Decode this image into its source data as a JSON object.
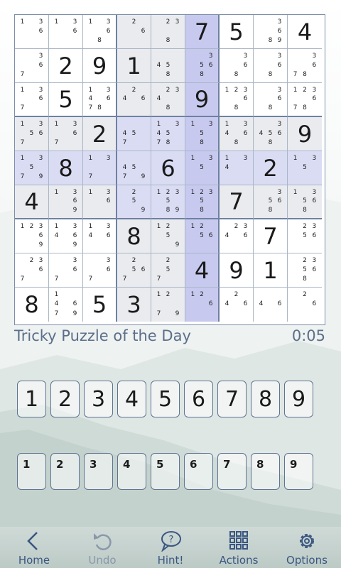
{
  "theme": {
    "accent": "#3a5780",
    "highlight": "#dadcf4",
    "selected": "#b7b9ea",
    "grid_line": "#6e81a1",
    "box_shade": "#e9ebee"
  },
  "board": {
    "selected_cell": [
      4,
      5
    ],
    "cells": [
      [
        {
          "n": [
            1,
            3,
            6
          ]
        },
        {
          "n": [
            1,
            3,
            6
          ]
        },
        {
          "n": [
            1,
            3,
            6,
            8
          ]
        },
        {
          "n": [
            2,
            6
          ]
        },
        {
          "n": [
            2,
            3,
            8
          ]
        },
        {
          "v": 7
        },
        {
          "v": 5
        },
        {
          "n": [
            3,
            6,
            8,
            9
          ]
        },
        {
          "v": 4
        }
      ],
      [
        {
          "n": [
            3,
            6,
            7
          ]
        },
        {
          "v": 2
        },
        {
          "v": 9
        },
        {
          "v": 1
        },
        {
          "n": [
            4,
            5,
            8
          ]
        },
        {
          "n": [
            3,
            5,
            6,
            8
          ]
        },
        {
          "n": [
            3,
            6,
            8
          ]
        },
        {
          "n": [
            3,
            6,
            8
          ]
        },
        {
          "n": [
            3,
            6,
            7,
            8
          ]
        }
      ],
      [
        {
          "n": [
            1,
            3,
            6,
            7
          ]
        },
        {
          "v": 5
        },
        {
          "n": [
            1,
            3,
            4,
            6,
            7,
            8
          ]
        },
        {
          "n": [
            2,
            4,
            6
          ]
        },
        {
          "n": [
            2,
            3,
            4,
            8
          ]
        },
        {
          "v": 9
        },
        {
          "n": [
            1,
            2,
            3,
            6,
            8
          ]
        },
        {
          "n": [
            3,
            6,
            8
          ]
        },
        {
          "n": [
            1,
            2,
            3,
            6,
            7,
            8
          ]
        }
      ],
      [
        {
          "n": [
            1,
            3,
            5,
            6,
            7
          ]
        },
        {
          "n": [
            1,
            3,
            6,
            7
          ]
        },
        {
          "v": 2
        },
        {
          "n": [
            4,
            5,
            7
          ]
        },
        {
          "n": [
            1,
            3,
            4,
            5,
            7,
            8
          ]
        },
        {
          "n": [
            1,
            3,
            5,
            8
          ]
        },
        {
          "n": [
            1,
            3,
            4,
            6,
            8
          ]
        },
        {
          "n": [
            3,
            4,
            5,
            6,
            8
          ]
        },
        {
          "v": 9
        }
      ],
      [
        {
          "n": [
            1,
            3,
            5,
            7,
            9
          ]
        },
        {
          "v": 8
        },
        {
          "n": [
            1,
            3,
            7
          ]
        },
        {
          "n": [
            4,
            5,
            7,
            9
          ]
        },
        {
          "v": 6
        },
        {
          "n": [
            1,
            3,
            5
          ]
        },
        {
          "n": [
            1,
            3,
            4
          ]
        },
        {
          "v": 2
        },
        {
          "n": [
            1,
            3,
            5
          ]
        }
      ],
      [
        {
          "v": 4
        },
        {
          "n": [
            1,
            3,
            6,
            9
          ]
        },
        {
          "n": [
            1,
            3,
            6
          ]
        },
        {
          "n": [
            2,
            5,
            9
          ]
        },
        {
          "n": [
            1,
            2,
            3,
            5,
            8,
            9
          ]
        },
        {
          "n": [
            1,
            2,
            3,
            5,
            8
          ]
        },
        {
          "v": 7
        },
        {
          "n": [
            3,
            5,
            6,
            8
          ]
        },
        {
          "n": [
            1,
            3,
            5,
            6,
            8
          ]
        }
      ],
      [
        {
          "n": [
            1,
            2,
            3,
            6,
            9
          ]
        },
        {
          "n": [
            1,
            3,
            4,
            6,
            9
          ]
        },
        {
          "n": [
            1,
            3,
            4,
            6
          ]
        },
        {
          "v": 8
        },
        {
          "n": [
            1,
            2,
            5,
            9
          ]
        },
        {
          "n": [
            1,
            2,
            5,
            6
          ]
        },
        {
          "n": [
            2,
            3,
            4,
            6
          ]
        },
        {
          "v": 7
        },
        {
          "n": [
            2,
            3,
            5,
            6
          ]
        }
      ],
      [
        {
          "n": [
            2,
            3,
            6,
            7
          ]
        },
        {
          "n": [
            3,
            6,
            7
          ]
        },
        {
          "n": [
            3,
            6,
            7
          ]
        },
        {
          "n": [
            2,
            5,
            6,
            7
          ]
        },
        {
          "n": [
            2,
            5,
            7
          ]
        },
        {
          "v": 4
        },
        {
          "v": 9
        },
        {
          "v": 1
        },
        {
          "n": [
            2,
            3,
            5,
            6,
            8
          ]
        }
      ],
      [
        {
          "v": 8
        },
        {
          "n": [
            1,
            4,
            6,
            7,
            9
          ]
        },
        {
          "v": 5
        },
        {
          "v": 3
        },
        {
          "n": [
            1,
            2,
            7,
            9
          ]
        },
        {
          "n": [
            1,
            2,
            6
          ]
        },
        {
          "n": [
            2,
            4,
            6
          ]
        },
        {
          "n": [
            4,
            6
          ]
        },
        {
          "n": [
            2,
            6
          ]
        }
      ]
    ]
  },
  "status": {
    "title": "Tricky Puzzle of the Day",
    "timer": "0:05"
  },
  "digit_keys": [
    "1",
    "2",
    "3",
    "4",
    "5",
    "6",
    "7",
    "8",
    "9"
  ],
  "note_keys": [
    "1",
    "2",
    "3",
    "4",
    "5",
    "6",
    "7",
    "8",
    "9"
  ],
  "toolbar": {
    "items": [
      {
        "id": "home",
        "label": "Home",
        "icon": "chevron-left-icon",
        "enabled": true
      },
      {
        "id": "undo",
        "label": "Undo",
        "icon": "undo-arrow-icon",
        "enabled": false
      },
      {
        "id": "hint",
        "label": "Hint!",
        "icon": "speech-bubble-question-icon",
        "enabled": true
      },
      {
        "id": "actions",
        "label": "Actions",
        "icon": "grid-icon",
        "enabled": true
      },
      {
        "id": "options",
        "label": "Options",
        "icon": "gear-icon",
        "enabled": true
      }
    ]
  }
}
